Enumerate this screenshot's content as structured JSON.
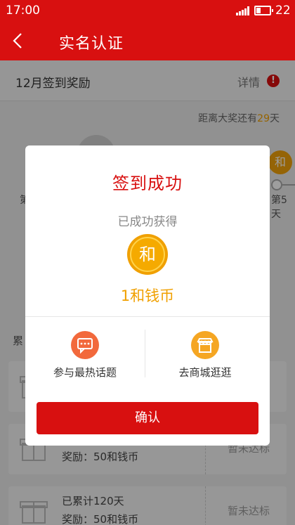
{
  "status_bar": {
    "time": "17:00",
    "battery": "22"
  },
  "nav": {
    "title": "实名认证"
  },
  "sign_header": {
    "title": "12月签到奖励",
    "detail": "详情",
    "badge": "!"
  },
  "countdown": {
    "prefix": "距离大奖还有",
    "days": "29",
    "suffix": "天"
  },
  "calendar": {
    "left_day": "第",
    "right_day": "第5天",
    "coin_char": "和"
  },
  "section_label": "累",
  "cards": [
    {
      "line1": "",
      "line2": "",
      "status": ""
    },
    {
      "line1": "",
      "line2": "奖励：50和钱币",
      "status": "暂未达标"
    },
    {
      "line1": "已累计120天",
      "line2": "奖励：50和钱币",
      "status": "暂未达标"
    }
  ],
  "dialog": {
    "title": "签到成功",
    "subtitle": "已成功获得",
    "coin_char": "和",
    "amount": "1和钱币",
    "actions": [
      {
        "label": "参与最热话题",
        "icon": "chat-icon",
        "color": "#f2693c"
      },
      {
        "label": "去商城逛逛",
        "icon": "shop-icon",
        "color": "#f5a623"
      }
    ],
    "confirm": "确认"
  },
  "colors": {
    "brand_red": "#d81010",
    "coin_gold": "#f0a000"
  }
}
